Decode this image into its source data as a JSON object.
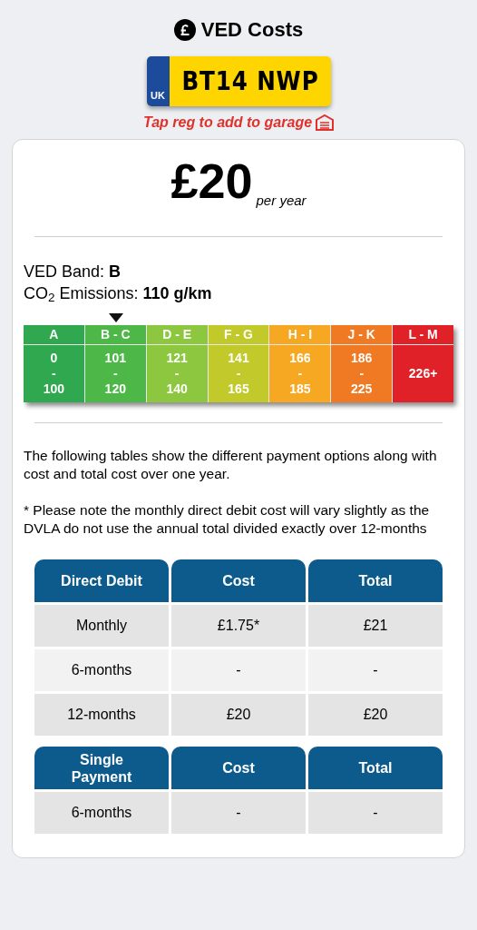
{
  "header": {
    "title": "VED Costs"
  },
  "plate": {
    "country": "UK",
    "registration": "BT14 NWP",
    "hint": "Tap reg to add to garage"
  },
  "price": {
    "amount": "£20",
    "period": "per year"
  },
  "band_info": [
    "VED Band: **B**",
    "CO$_{2}$ Emissions: **110 g/km**"
  ],
  "bands": [
    {
      "label": "A",
      "kind": "range",
      "from": "0",
      "sep": "-",
      "to": "100",
      "color": "#2fa84f",
      "selected": false
    },
    {
      "label": "B - C",
      "kind": "range",
      "from": "101",
      "sep": "-",
      "to": "120",
      "color": "#4db848",
      "selected": true
    },
    {
      "label": "D - E",
      "kind": "range",
      "from": "121",
      "sep": "-",
      "to": "140",
      "color": "#8dc63f",
      "selected": false
    },
    {
      "label": "F - G",
      "kind": "range",
      "from": "141",
      "sep": "-",
      "to": "165",
      "color": "#c2c92a",
      "selected": false
    },
    {
      "label": "H - I",
      "kind": "range",
      "from": "166",
      "sep": "-",
      "to": "185",
      "color": "#f7a823",
      "selected": false
    },
    {
      "label": "J - K",
      "kind": "range",
      "from": "186",
      "sep": "-",
      "to": "225",
      "color": "#f07a23",
      "selected": false
    },
    {
      "label": "L - M",
      "kind": "single",
      "value": "226+",
      "color": "#e02128",
      "selected": false
    }
  ],
  "notes": [
    "The following tables show the different payment options along with cost and total cost over one year.",
    "* Please note the monthly direct debit cost will vary slightly as the DVLA do not use the annual total divided exactly over 12-months"
  ],
  "tables": [
    {
      "columns": [
        "Direct Debit",
        "Cost",
        "Total"
      ],
      "rows": [
        [
          "Monthly",
          "£1.75*",
          "£21"
        ],
        [
          "6-months",
          "-",
          "-"
        ],
        [
          "12-months",
          "£20",
          "£20"
        ]
      ]
    },
    {
      "columns": [
        "Single Payment",
        "Cost",
        "Total"
      ],
      "rows": [
        [
          "6-months",
          "-",
          "-"
        ]
      ]
    }
  ]
}
